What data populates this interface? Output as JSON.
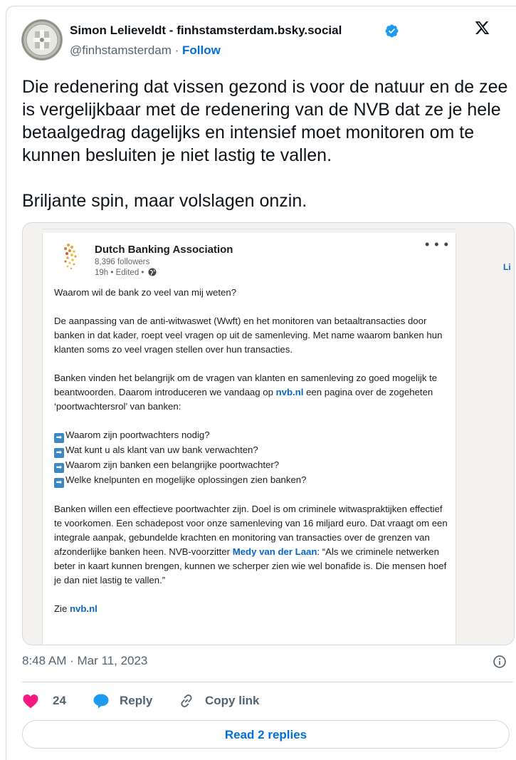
{
  "author": {
    "name": "Simon Lelieveldt - finhstamsterdam.bsky.social",
    "handle": "@finhstamsterdam",
    "separator": " · ",
    "follow_label": "Follow"
  },
  "tweet": {
    "text": "Die redenering dat vissen gezond is voor de natuur en de zee is vergelijkbaar met de redenering van de NVB dat ze je hele betaalgedrag dagelijks en intensief moet monitoren om te kunnen besluiten je niet lastig te vallen.\n\nBriljante spin, maar volslagen onzin.",
    "timestamp": "8:48 AM · Mar 11, 2023"
  },
  "embedded_post": {
    "org_name": "Dutch Banking Association",
    "followers": "8,396 followers",
    "time": "19h • Edited • ",
    "more": "• • •",
    "side_text": "Li",
    "heading": "Waarom wil de bank zo veel van mij weten?",
    "para1": "De aanpassing van de anti-witwaswet (Wwft) en het monitoren van betaaltransacties door banken in dat kader, roept veel vragen op uit de samenleving. Met name waarom banken hun klanten soms zo veel vragen stellen over hun transacties.",
    "para2_a": "Banken vinden het belangrijk om de vragen van klanten en samenleving zo goed mogelijk te beantwoorden. Daarom introduceren we vandaag op ",
    "para2_link": "nvb.nl",
    "para2_b": " een pagina over de zogeheten ‘poortwachtersrol’ van banken:",
    "arrow_glyph": "➡",
    "bullets": [
      "Waarom zijn poortwachters nodig?",
      "Wat kunt u als klant van uw bank verwachten?",
      "Waarom zijn banken een belangrijke poortwachter?",
      "Welke knelpunten en mogelijke oplossingen zien banken?"
    ],
    "para3_a": "Banken willen een effectieve poortwachter zijn. Doel is om criminele witwaspraktijken effectief te voorkomen. Een schadepost voor onze samenleving van 16 miljard euro. Dat vraagt om een integrale aanpak, gebundelde krachten en monitoring van transacties over de grenzen van afzonderlijke banken heen. NVB-voorzitter ",
    "para3_link": "Medy van der Laan",
    "para3_b": ": “Als we criminele netwerken beter in kaart kunnen brengen, kunnen we scherper zien wie wel bonafide is. Die mensen hoef je dan niet lastig te vallen.”",
    "zie": "Zie ",
    "zie_link": "nvb.nl"
  },
  "actions": {
    "likes": "24",
    "reply_label": "Reply",
    "copy_label": "Copy link",
    "read_replies": "Read 2 replies"
  },
  "colors": {
    "link": "#006fd6",
    "like": "#f91880",
    "reply": "#1d9bf0",
    "linkedin_link": "#0a66c2",
    "verified": "#1d9bf0"
  },
  "icons": [
    "verified-badge-icon",
    "x-logo-icon",
    "globe-icon",
    "info-icon",
    "heart-icon",
    "reply-bubble-icon",
    "link-icon",
    "arrow-right-icon"
  ]
}
